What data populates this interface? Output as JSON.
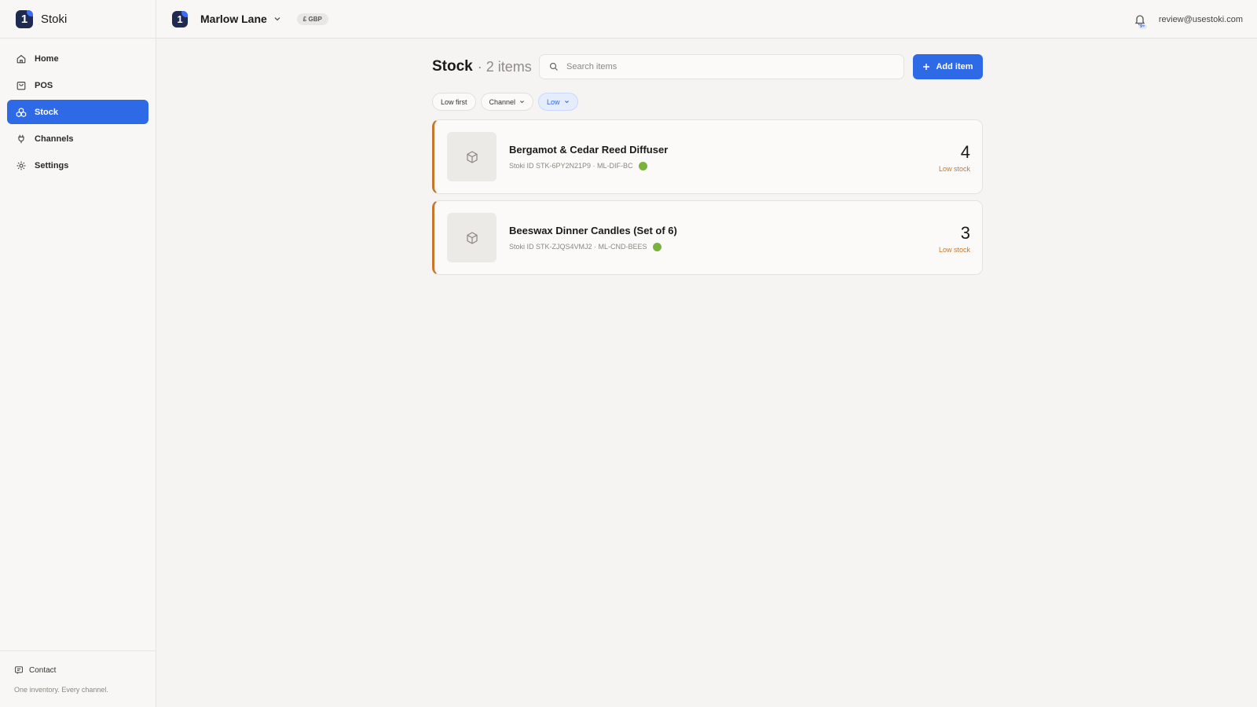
{
  "app": {
    "name": "Stoki",
    "logo_glyph": "1"
  },
  "sidebar": {
    "items": [
      {
        "label": "Home",
        "icon": "home-icon"
      },
      {
        "label": "POS",
        "icon": "bag-icon"
      },
      {
        "label": "Stock",
        "icon": "boxes-icon",
        "active": true
      },
      {
        "label": "Channels",
        "icon": "plug-icon"
      },
      {
        "label": "Settings",
        "icon": "gear-icon"
      }
    ],
    "contact_label": "Contact",
    "tagline": "One inventory. Every channel."
  },
  "topbar": {
    "store_name": "Marlow Lane",
    "currency": "£ GBP",
    "notification_badge": "9+",
    "user_email": "review@usestoki.com"
  },
  "main": {
    "title": "Stock",
    "count_text": "· 2 items",
    "search_placeholder": "Search items",
    "add_button_label": "Add item",
    "filters": [
      {
        "label": "Low first",
        "dropdown": false,
        "active": false
      },
      {
        "label": "Channel",
        "dropdown": true,
        "active": false
      },
      {
        "label": "Low",
        "dropdown": true,
        "active": true
      }
    ],
    "items": [
      {
        "name": "Bergamot & Cedar Reed Diffuser",
        "stoki_id": "Stoki ID STK-6PY2N21P9",
        "sku": "· ML-DIF-BC",
        "quantity": "4",
        "status": "Low stock"
      },
      {
        "name": "Beeswax Dinner Candles (Set of 6)",
        "stoki_id": "Stoki ID STK-ZJQS4VMJ2",
        "sku": "· ML-CND-BEES",
        "quantity": "3",
        "status": "Low stock"
      }
    ]
  },
  "colors": {
    "accent": "#2e6ae6",
    "low_stock": "#c6772c",
    "channel_ok": "#7ab33c",
    "background": "#f5f4f2"
  }
}
